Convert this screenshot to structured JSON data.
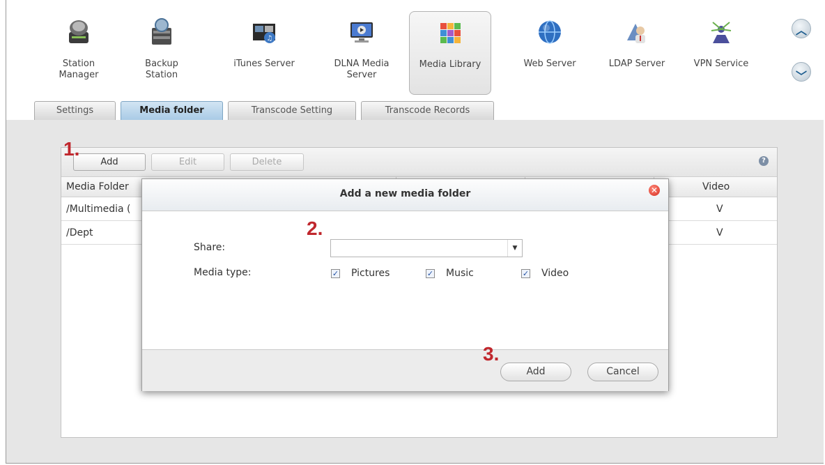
{
  "apps": [
    {
      "label": "Station\nManager",
      "icon": "station-manager-icon"
    },
    {
      "label": "Backup\nStation",
      "icon": "backup-station-icon"
    },
    {
      "label": "iTunes Server",
      "icon": "itunes-server-icon"
    },
    {
      "label": "DLNA Media\nServer",
      "icon": "dlna-media-server-icon"
    },
    {
      "label": "Media Library",
      "icon": "media-library-icon"
    },
    {
      "label": "Web Server",
      "icon": "web-server-icon"
    },
    {
      "label": "LDAP Server",
      "icon": "ldap-server-icon"
    },
    {
      "label": "VPN Service",
      "icon": "vpn-service-icon"
    }
  ],
  "nav": {
    "up_icon": "chevron-up-icon",
    "down_icon": "chevron-down-icon"
  },
  "tabs": [
    {
      "label": "Settings"
    },
    {
      "label": "Media folder"
    },
    {
      "label": "Transcode Setting"
    },
    {
      "label": "Transcode Records"
    }
  ],
  "toolbar": {
    "add": "Add",
    "edit": "Edit",
    "delete": "Delete",
    "help_icon": "help-icon"
  },
  "grid": {
    "col_media_folder": "Media Folder",
    "col_video": "Video",
    "rows": [
      {
        "folder": "/Multimedia (",
        "video": "V"
      },
      {
        "folder": "/Dept",
        "video": "V"
      }
    ]
  },
  "markers": {
    "step1": "1.",
    "step2": "2.",
    "step3": "3."
  },
  "dialog": {
    "title": "Add a new media folder",
    "share_label": "Share:",
    "share_value": "",
    "media_type_label": "Media type:",
    "pictures": "Pictures",
    "music": "Music",
    "video": "Video",
    "check_mark": "✓",
    "add": "Add",
    "cancel": "Cancel"
  },
  "colors": {
    "accent_tab": "#a9cbe6",
    "marker_red": "#c0272d"
  }
}
